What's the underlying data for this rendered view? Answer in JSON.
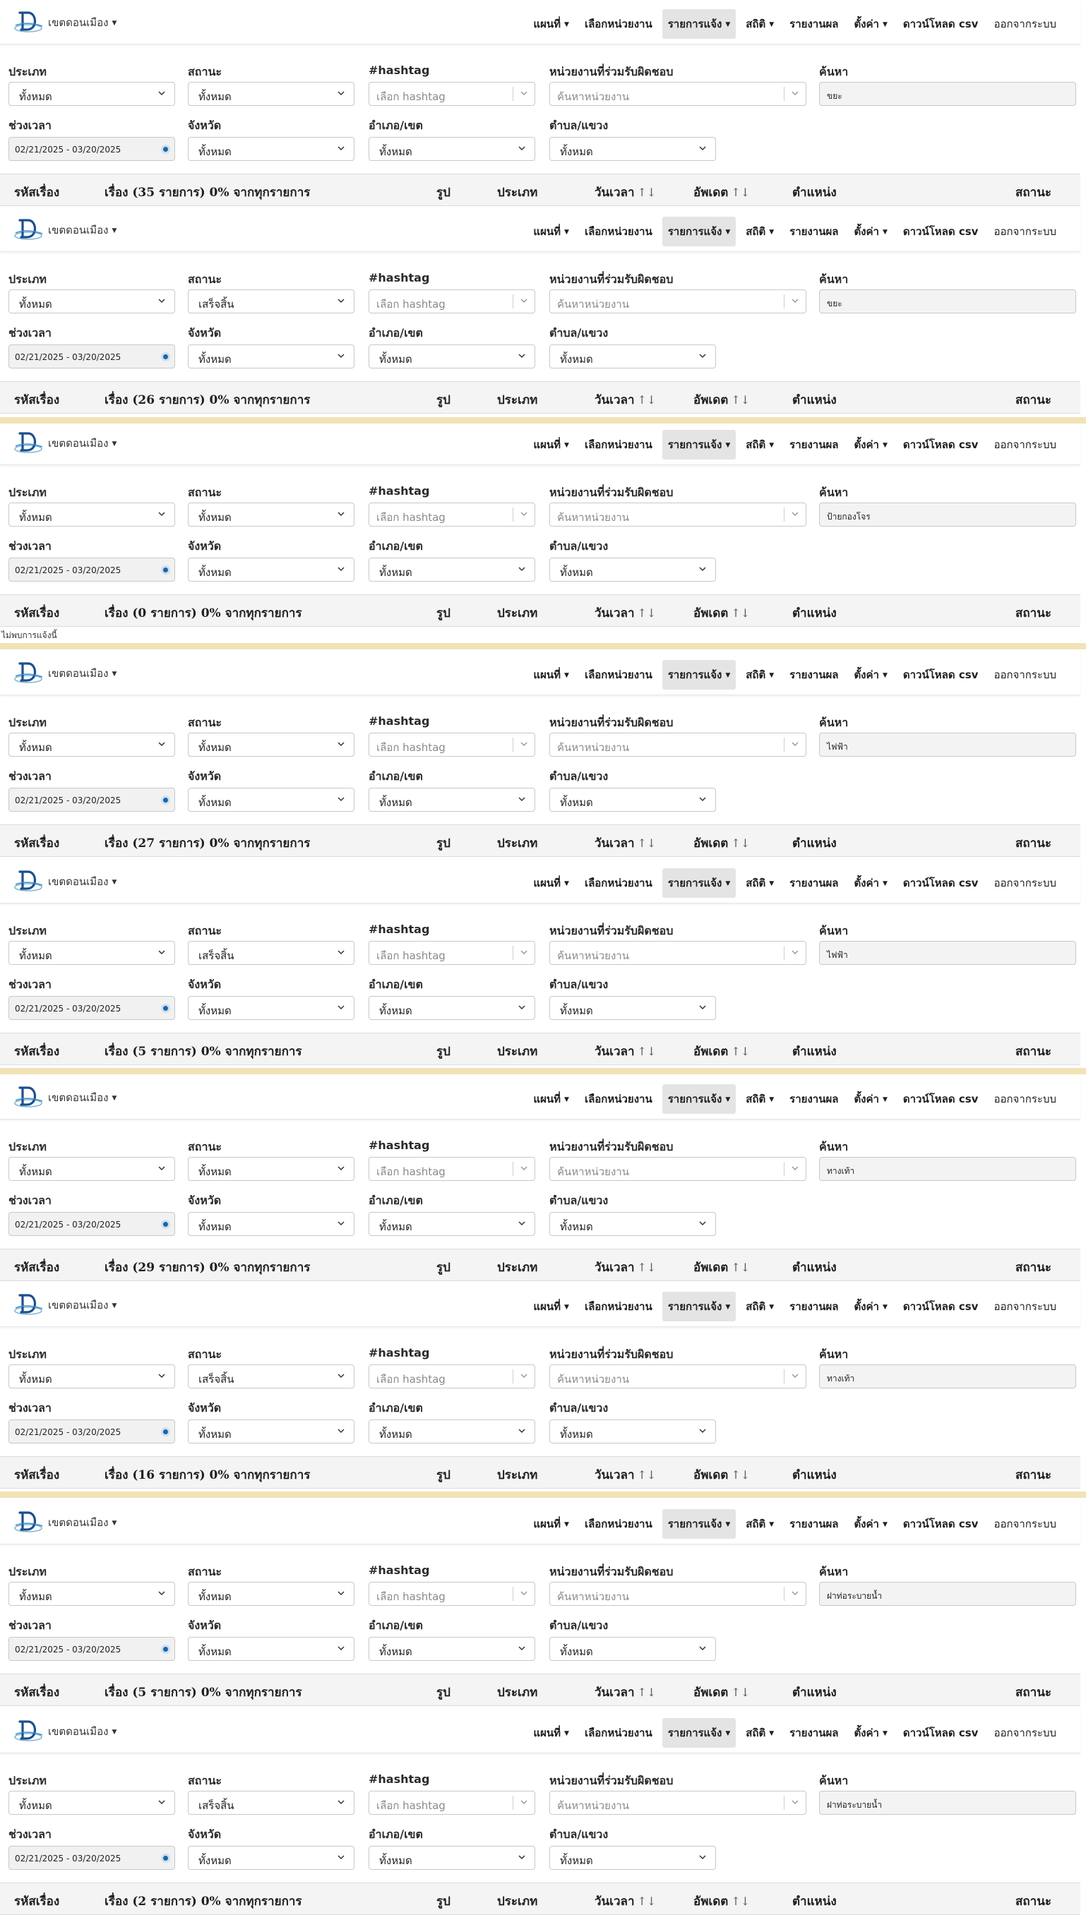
{
  "brand": "เขตดอนเมือง",
  "nav": {
    "map": "แผนที่",
    "select_unit": "เลือกหน่วยงาน",
    "reports": "รายการแจ้ง",
    "stats": "สถิติ",
    "report_results": "รายงานผล",
    "settings": "ตั้งค่า",
    "download_csv": "ดาวน์โหลด csv",
    "logout": "ออกจากระบบ"
  },
  "labels": {
    "type": "ประเภท",
    "status": "สถานะ",
    "hashtag": "#hashtag",
    "unit": "หน่วยงานที่ร่วมรับผิดชอบ",
    "search": "ค้นหา",
    "period": "ช่วงเวลา",
    "province": "จังหวัด",
    "district": "อำเภอ/เขต",
    "subdistrict": "ตำบล/แขวง"
  },
  "filters": {
    "type_value": "ทั้งหมด",
    "province_value": "ทั้งหมด",
    "district_value": "ทั้งหมด",
    "subdistrict_value": "ทั้งหมด",
    "hashtag_placeholder": "เลือก hashtag",
    "unit_placeholder": "ค้นหาหน่วยงาน",
    "date_range": "02/21/2025 - 03/20/2025"
  },
  "table": {
    "id": "รหัสเรื่อง",
    "image": "รูป",
    "type": "ประเภท",
    "datetime": "วันเวลา",
    "updated": "อัพเดต",
    "position": "ตำแหน่ง",
    "status": "สถานะ",
    "sort_glyph": "↑↓"
  },
  "panels": [
    {
      "status": "ทั้งหมด",
      "search": "ขยะ",
      "count_text": "เรื่อง (35 รายการ) 0% จากทุกรายการ"
    },
    {
      "status": "เสร็จสิ้น",
      "search": "ขยะ",
      "count_text": "เรื่อง (26 รายการ) 0% จากทุกรายการ"
    },
    {
      "status": "ทั้งหมด",
      "search": "ป้ายกองโจร",
      "count_text": "เรื่อง (0 รายการ) 0% จากทุกรายการ",
      "empty": "ไม่พบการแจ้งนี้"
    },
    {
      "status": "ทั้งหมด",
      "search": "ไฟฟ้า",
      "count_text": "เรื่อง (27 รายการ) 0% จากทุกรายการ"
    },
    {
      "status": "เสร็จสิ้น",
      "search": "ไฟฟ้า",
      "count_text": "เรื่อง (5 รายการ) 0% จากทุกรายการ"
    },
    {
      "status": "ทั้งหมด",
      "search": "ทางเท้า",
      "count_text": "เรื่อง (29 รายการ) 0% จากทุกรายการ"
    },
    {
      "status": "เสร็จสิ้น",
      "search": "ทางเท้า",
      "count_text": "เรื่อง (16 รายการ) 0% จากทุกรายการ"
    },
    {
      "status": "ทั้งหมด",
      "search": "ฝาท่อระบายน้ำ",
      "count_text": "เรื่อง (5 รายการ) 0% จากทุกรายการ"
    },
    {
      "status": "เสร็จสิ้น",
      "search": "ฝาท่อระบายน้ำ",
      "count_text": "เรื่อง (2 รายการ) 0% จากทุกรายการ"
    }
  ]
}
